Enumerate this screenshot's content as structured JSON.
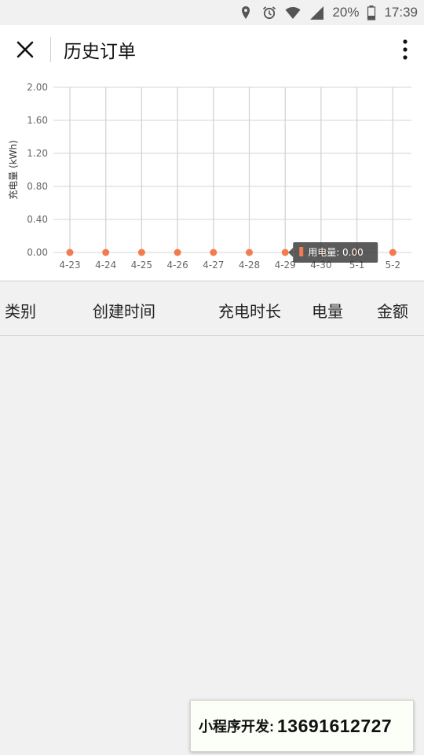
{
  "status_bar": {
    "battery": "20%",
    "time": "17:39",
    "icons": [
      "location-icon",
      "alarm-icon",
      "wifi-icon",
      "signal-icon",
      "battery-icon"
    ]
  },
  "header": {
    "title": "历史订单",
    "close_icon": "close-icon",
    "more_icon": "more-vertical-icon"
  },
  "chart_data": {
    "type": "line",
    "ylabel": "充电量 (kWh)",
    "x": [
      "4-23",
      "4-24",
      "4-25",
      "4-26",
      "4-27",
      "4-28",
      "4-29",
      "4-30",
      "5-1",
      "5-2"
    ],
    "series": [
      {
        "name": "用电量",
        "values": [
          0,
          0,
          0,
          0,
          0,
          0,
          0,
          0,
          0,
          0
        ],
        "color": "#f27c4f"
      }
    ],
    "ylim": [
      0,
      2
    ],
    "yticks": [
      "0.00",
      "0.40",
      "0.80",
      "1.20",
      "1.60",
      "2.00"
    ],
    "grid": true,
    "tooltip": {
      "label": "用电量: 0.00",
      "index": 6
    }
  },
  "table": {
    "columns": [
      "类别",
      "创建时间",
      "充电时长",
      "电量",
      "金额"
    ]
  },
  "promo": {
    "label": "小程序开发:",
    "phone": "13691612727"
  }
}
